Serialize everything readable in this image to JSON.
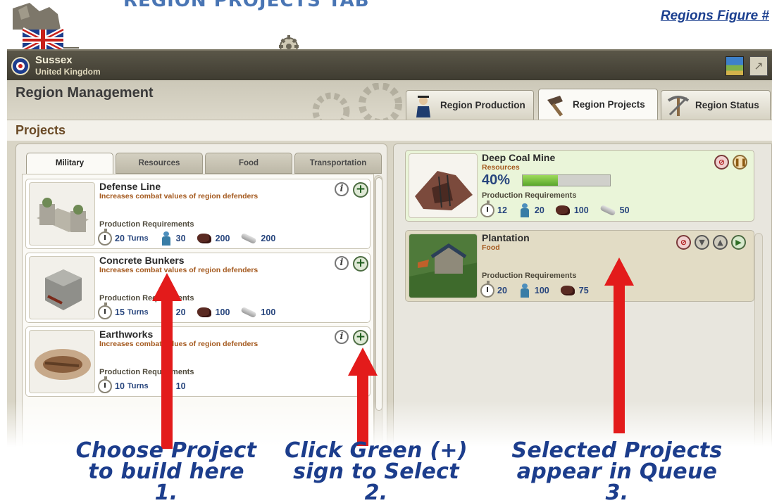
{
  "header": {
    "banner": "REGION PROJECTS TAB",
    "figure_label": "Regions Figure #"
  },
  "titlebar": {
    "region": "Sussex",
    "country": "United Kingdom"
  },
  "panel": {
    "title": "Region Management",
    "tabs": [
      {
        "label": "Region Production",
        "icon": "soldier-icon"
      },
      {
        "label": "Region Projects",
        "icon": "hammer-icon"
      },
      {
        "label": "Region Status",
        "icon": "pickaxe-icon"
      }
    ],
    "active_tab": "Region Projects",
    "section_label": "Projects"
  },
  "categories": [
    "Military",
    "Resources",
    "Food",
    "Transportation"
  ],
  "active_category": "Military",
  "projects": [
    {
      "name": "Defense Line",
      "desc": "Increases combat values of region defenders",
      "req_label": "Production Requirements",
      "turns": "20",
      "turns_unit": "Turns",
      "workers": "30",
      "coal": "200",
      "steel": "200"
    },
    {
      "name": "Concrete Bunkers",
      "desc": "Increases combat values of region defenders",
      "req_label": "Production Requirements",
      "turns": "15",
      "turns_unit": "Turns",
      "workers": "20",
      "coal": "100",
      "steel": "100"
    },
    {
      "name": "Earthworks",
      "desc": "Increases combat values of region defenders",
      "req_label": "Production Requirements",
      "turns": "10",
      "turns_unit": "Turns",
      "workers": "10"
    }
  ],
  "queue": [
    {
      "name": "Deep Coal Mine",
      "category": "Resources",
      "progress_label": "40%",
      "progress": 0.4,
      "req_label": "Production Requirements",
      "turns": "12",
      "workers": "20",
      "coal": "100",
      "steel": "50"
    },
    {
      "name": "Plantation",
      "category": "Food",
      "req_label": "Production Requirements",
      "turns": "20",
      "workers": "100",
      "coal": "75"
    }
  ],
  "annotations": [
    {
      "line1": "Choose Project",
      "line2": "to build here",
      "line3": "1."
    },
    {
      "line1": "Click Green (+)",
      "line2": "sign to Select",
      "line3": "2."
    },
    {
      "line1": "Selected Projects",
      "line2": "appear in Queue",
      "line3": "3."
    }
  ],
  "colors": {
    "accent_red": "#e31b1b",
    "annotation_blue": "#1c3d8c",
    "title_bar": "#4b473b"
  }
}
